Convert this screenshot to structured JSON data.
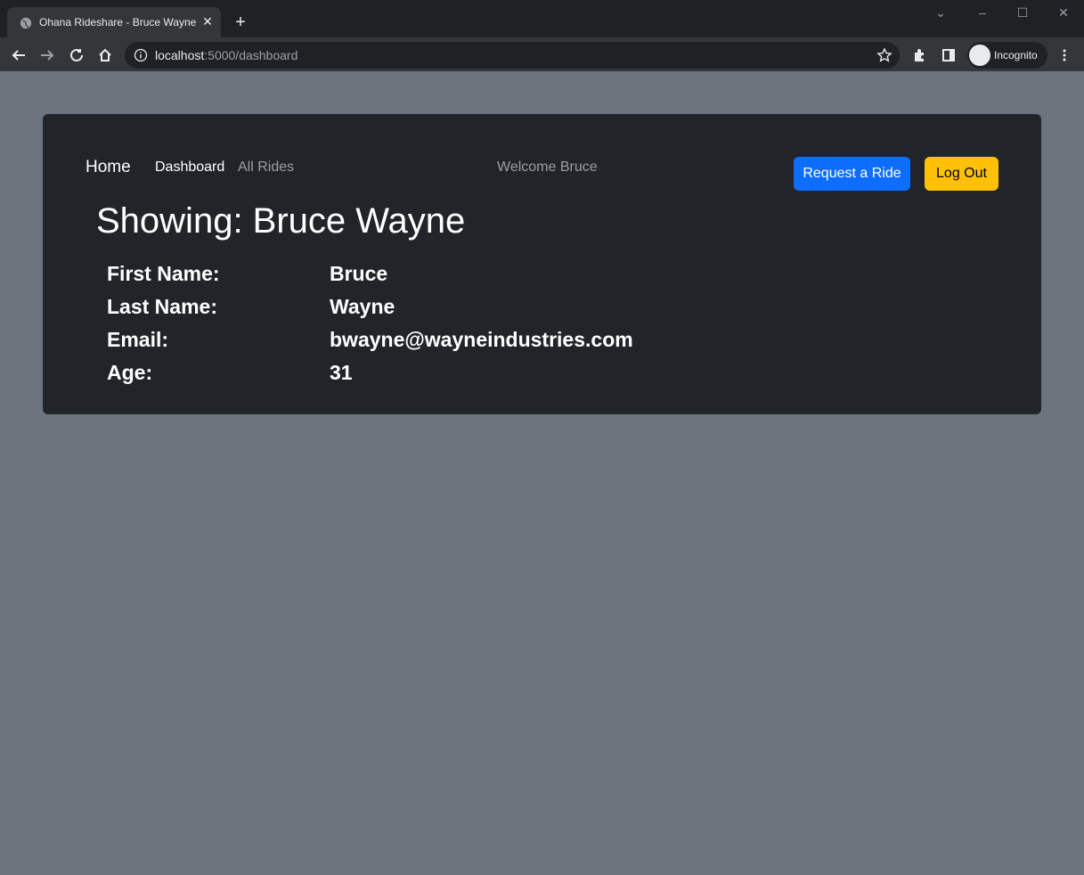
{
  "browser": {
    "tab_title": "Ohana Rideshare - Bruce Wayne",
    "url_host": "localhost",
    "url_path": ":5000/dashboard",
    "profile_label": "Incognito"
  },
  "nav": {
    "home": "Home",
    "dashboard": "Dashboard",
    "all_rides": "All Rides",
    "welcome": "Welcome Bruce",
    "request_ride": "Request a Ride",
    "log_out": "Log Out"
  },
  "main": {
    "heading": "Showing: Bruce Wayne",
    "fields": [
      {
        "label": "First Name:",
        "value": "Bruce"
      },
      {
        "label": "Last Name:",
        "value": "Wayne"
      },
      {
        "label": "Email:",
        "value": "bwayne@wayneindustries.com"
      },
      {
        "label": "Age:",
        "value": "31"
      }
    ]
  },
  "colors": {
    "page_bg": "#6c757d",
    "card_bg": "#212529",
    "primary": "#0d6efd",
    "warning": "#ffc107"
  }
}
